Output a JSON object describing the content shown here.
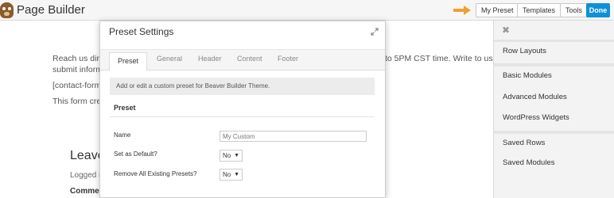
{
  "topbar": {
    "title": "Page Builder",
    "buttons": {
      "my_preset": "My Preset",
      "templates": "Templates",
      "tools": "Tools",
      "done": "Done"
    },
    "arrow_color": "#f0a030",
    "done_color": "#0e91d8"
  },
  "page": {
    "line1_start": "Reach us dire",
    "line1_end": "to 5PM CST time. Write to us v",
    "line2": "submit inform",
    "line3": "[contact-form-",
    "line4": "This form crea",
    "leave_heading": "Leave",
    "logged_text": "Logged i",
    "comment_label": "Comme"
  },
  "right_panel": {
    "close_icon": "close-icon",
    "items": [
      "Row Layouts",
      "Basic Modules",
      "Advanced Modules",
      "WordPress Widgets",
      "Saved Rows",
      "Saved Modules"
    ]
  },
  "modal": {
    "title": "Preset Settings",
    "tabs": [
      "Preset",
      "General",
      "Header",
      "Content",
      "Footer"
    ],
    "active_tab": "Preset",
    "info_text": "Add or edit a custom preset for Beaver Builder Theme.",
    "section_title": "Preset",
    "fields": {
      "name_label": "Name",
      "name_placeholder": "My Custom",
      "default_label": "Set as Default?",
      "default_value": "No",
      "remove_label": "Remove All Existing Presets?",
      "remove_value": "No"
    }
  }
}
